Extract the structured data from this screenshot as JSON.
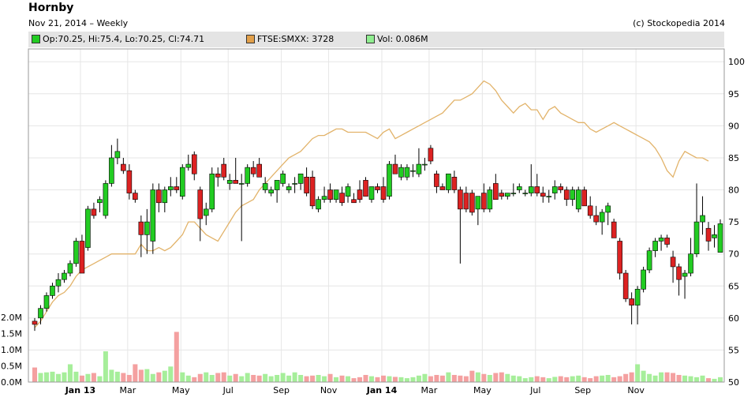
{
  "header": {
    "title": "Hornby",
    "subtitle": "Nov 21, 2014 – Weekly",
    "credit": "(c) Stockopedia 2014"
  },
  "legend": {
    "items": [
      {
        "label": "Op:70.25, Hi:75.4, Lo:70.25, Cl:74.71",
        "color": "#22cc22"
      },
      {
        "label": "FTSE:SMXX: 3728",
        "color": "#e2a04a"
      },
      {
        "label": "Vol: 0.086M",
        "color": "#90ee90"
      }
    ]
  },
  "chart_data": {
    "type": "candlestick",
    "x_ticks": [
      "Jan 13",
      "Mar",
      "May",
      "Jul",
      "Sep",
      "Nov",
      "Jan 14",
      "Mar",
      "May",
      "Jul",
      "Sep",
      "Nov"
    ],
    "y_ticks": [
      "100",
      "95",
      "90",
      "85",
      "80",
      "75",
      "70",
      "65",
      "60",
      "55",
      "50"
    ],
    "ylim": [
      50,
      102
    ],
    "volume_ticks": [
      "2.0M",
      "1.5M",
      "1.0M",
      "0.5M",
      "0.0M"
    ],
    "volume_lim": [
      0,
      2.0
    ],
    "colors": {
      "up": "#22cc22",
      "down": "#dd2222",
      "index_line": "#e2b36a",
      "vol_up": "#a6ee9a",
      "vol_down": "#f4a0a0",
      "vol_flat": "#c0c0c0"
    },
    "price": {
      "name": "Hornby",
      "candles": [
        [
          59.5,
          60.0,
          58.0,
          59.0
        ],
        [
          60.0,
          62.0,
          59.0,
          61.5
        ],
        [
          61.5,
          64.0,
          61.0,
          63.5
        ],
        [
          63.5,
          65.5,
          63.0,
          65.0
        ],
        [
          65.0,
          67.0,
          64.0,
          66.0
        ],
        [
          66.0,
          67.5,
          65.5,
          67.0
        ],
        [
          67.0,
          69.0,
          66.5,
          68.5
        ],
        [
          68.5,
          72.5,
          68.0,
          72.0
        ],
        [
          72.0,
          73.0,
          68.5,
          67.0
        ],
        [
          71.0,
          77.5,
          70.5,
          77.0
        ],
        [
          77.0,
          78.0,
          75.5,
          76.0
        ],
        [
          78.0,
          79.0,
          76.5,
          78.5
        ],
        [
          76.0,
          81.5,
          75.5,
          81.0
        ],
        [
          81.0,
          87.0,
          80.5,
          85.0
        ],
        [
          85.0,
          88.0,
          84.0,
          86.0
        ],
        [
          84.0,
          85.0,
          82.5,
          83.0
        ],
        [
          83.0,
          84.0,
          78.5,
          79.5
        ],
        [
          79.5,
          80.0,
          78.0,
          78.5
        ],
        [
          75.0,
          76.0,
          69.5,
          73.0
        ],
        [
          73.0,
          77.0,
          70.0,
          75.0
        ],
        [
          72.0,
          81.0,
          70.0,
          80.0
        ],
        [
          80.0,
          81.0,
          76.5,
          78.0
        ],
        [
          78.0,
          80.5,
          76.5,
          80.0
        ],
        [
          80.0,
          82.0,
          79.0,
          80.5
        ],
        [
          80.5,
          82.0,
          79.5,
          80.0
        ],
        [
          79.0,
          84.0,
          78.5,
          83.5
        ],
        [
          83.5,
          85.5,
          83.0,
          84.0
        ],
        [
          85.5,
          86.0,
          81.5,
          82.5
        ],
        [
          80.0,
          80.5,
          72.0,
          75.5
        ],
        [
          76.0,
          78.0,
          74.5,
          77.0
        ],
        [
          77.0,
          83.5,
          76.5,
          82.5
        ],
        [
          82.5,
          83.5,
          80.5,
          82.0
        ],
        [
          84.0,
          85.0,
          81.5,
          82.0
        ],
        [
          81.0,
          82.5,
          80.0,
          81.5
        ],
        [
          81.5,
          85.0,
          81.0,
          81.0
        ],
        [
          81.0,
          82.5,
          72.0,
          81.0
        ],
        [
          81.0,
          84.0,
          80.5,
          83.5
        ],
        [
          83.5,
          84.5,
          82.0,
          82.5
        ],
        [
          84.0,
          85.0,
          82.0,
          82.0
        ],
        [
          80.0,
          82.0,
          79.5,
          81.0
        ],
        [
          79.5,
          80.5,
          79.0,
          80.0
        ],
        [
          80.0,
          81.5,
          78.0,
          81.5
        ],
        [
          81.0,
          83.0,
          80.5,
          82.5
        ],
        [
          80.0,
          81.0,
          79.5,
          80.5
        ],
        [
          81.0,
          82.0,
          79.5,
          81.0
        ],
        [
          81.0,
          82.0,
          80.0,
          82.5
        ],
        [
          82.0,
          83.5,
          79.0,
          79.5
        ],
        [
          82.0,
          83.0,
          77.0,
          77.5
        ],
        [
          77.0,
          79.0,
          76.5,
          78.5
        ],
        [
          78.5,
          80.5,
          78.0,
          79.0
        ],
        [
          80.0,
          81.0,
          78.0,
          78.5
        ],
        [
          78.5,
          79.5,
          78.0,
          80.0
        ],
        [
          79.5,
          80.5,
          77.5,
          78.0
        ],
        [
          79.0,
          81.0,
          78.0,
          80.5
        ],
        [
          78.5,
          79.5,
          78.0,
          78.0
        ],
        [
          80.0,
          81.5,
          78.0,
          78.5
        ],
        [
          81.5,
          82.0,
          79.0,
          79.0
        ],
        [
          78.5,
          80.5,
          78.0,
          80.5
        ],
        [
          80.5,
          81.0,
          79.5,
          80.0
        ],
        [
          80.5,
          82.0,
          78.0,
          78.5
        ],
        [
          79.0,
          84.5,
          78.5,
          84.0
        ],
        [
          84.0,
          85.5,
          82.5,
          82.5
        ],
        [
          82.0,
          84.0,
          81.5,
          83.5
        ],
        [
          82.0,
          84.0,
          81.5,
          83.5
        ],
        [
          83.0,
          84.0,
          82.0,
          83.0
        ],
        [
          82.5,
          86.5,
          82.0,
          84.0
        ],
        [
          84.0,
          85.0,
          83.0,
          84.0
        ],
        [
          86.5,
          87.0,
          84.0,
          84.5
        ],
        [
          82.5,
          83.0,
          79.5,
          80.5
        ],
        [
          80.5,
          81.0,
          80.0,
          80.0
        ],
        [
          80.0,
          82.5,
          79.5,
          82.5
        ],
        [
          82.0,
          83.0,
          79.5,
          80.0
        ],
        [
          80.0,
          80.5,
          68.5,
          77.0
        ],
        [
          79.5,
          80.5,
          76.5,
          77.0
        ],
        [
          79.5,
          80.0,
          76.0,
          76.5
        ],
        [
          77.0,
          78.5,
          74.5,
          79.0
        ],
        [
          79.5,
          81.0,
          76.5,
          77.0
        ],
        [
          77.0,
          80.5,
          76.5,
          80.0
        ],
        [
          81.0,
          82.5,
          78.5,
          78.5
        ],
        [
          79.5,
          80.0,
          78.5,
          79.0
        ],
        [
          79.0,
          79.5,
          78.5,
          79.5
        ],
        [
          79.5,
          81.0,
          79.0,
          79.5
        ],
        [
          80.0,
          81.0,
          79.5,
          80.5
        ],
        [
          79.5,
          80.0,
          79.0,
          79.5
        ],
        [
          79.5,
          84.0,
          79.0,
          80.5
        ],
        [
          80.5,
          82.5,
          79.0,
          79.5
        ],
        [
          79.5,
          80.5,
          78.0,
          79.0
        ],
        [
          79.0,
          80.0,
          78.0,
          79.0
        ],
        [
          79.5,
          81.5,
          78.5,
          80.5
        ],
        [
          80.5,
          81.0,
          79.5,
          80.0
        ],
        [
          80.0,
          80.5,
          77.5,
          78.5
        ],
        [
          78.5,
          80.5,
          77.5,
          80.0
        ],
        [
          77.0,
          80.5,
          76.5,
          80.0
        ],
        [
          80.0,
          80.5,
          77.5,
          77.5
        ],
        [
          77.5,
          79.0,
          75.5,
          76.0
        ],
        [
          76.0,
          77.5,
          74.5,
          75.0
        ],
        [
          75.0,
          77.0,
          73.0,
          76.5
        ],
        [
          76.5,
          78.0,
          74.5,
          77.5
        ],
        [
          75.0,
          75.5,
          72.5,
          72.5
        ],
        [
          72.0,
          72.5,
          66.0,
          67.0
        ],
        [
          67.0,
          67.5,
          62.5,
          63.0
        ],
        [
          63.0,
          64.0,
          59.0,
          62.0
        ],
        [
          62.0,
          65.0,
          59.0,
          64.5
        ],
        [
          64.5,
          68.0,
          64.0,
          67.5
        ],
        [
          67.5,
          71.0,
          67.0,
          70.5
        ],
        [
          70.5,
          72.5,
          69.5,
          72.0
        ],
        [
          72.0,
          73.0,
          70.5,
          72.5
        ],
        [
          72.5,
          73.0,
          71.0,
          71.5
        ],
        [
          69.5,
          70.5,
          65.5,
          68.0
        ],
        [
          68.0,
          68.5,
          63.5,
          66.0
        ],
        [
          66.5,
          67.5,
          63.0,
          67.0
        ],
        [
          67.0,
          72.5,
          66.5,
          70.0
        ],
        [
          70.0,
          81.0,
          69.5,
          75.0
        ],
        [
          75.0,
          79.0,
          73.0,
          76.0
        ],
        [
          74.0,
          75.0,
          70.5,
          72.0
        ],
        [
          72.5,
          74.5,
          71.0,
          73.0
        ],
        [
          70.25,
          75.4,
          70.25,
          74.71
        ]
      ]
    },
    "index_series": {
      "name": "FTSE:SMXX",
      "values": [
        58.5,
        59.5,
        61.0,
        62.5,
        63.5,
        64.0,
        65.0,
        66.5,
        67.5,
        68.0,
        68.5,
        69.0,
        69.5,
        70.0,
        70.0,
        70.0,
        70.0,
        70.0,
        71.5,
        70.5,
        70.5,
        71.0,
        70.5,
        71.0,
        72.0,
        73.0,
        75.0,
        75.0,
        74.0,
        73.0,
        72.5,
        72.0,
        73.5,
        75.0,
        76.5,
        77.5,
        78.0,
        78.5,
        80.0,
        81.0,
        82.0,
        83.0,
        84.0,
        85.0,
        85.5,
        86.0,
        87.0,
        88.0,
        88.5,
        88.5,
        89.0,
        89.5,
        89.5,
        89.0,
        89.0,
        89.0,
        89.0,
        88.5,
        88.0,
        89.0,
        89.5,
        88.0,
        88.5,
        89.0,
        89.5,
        90.0,
        90.5,
        91.0,
        91.5,
        92.0,
        93.0,
        94.0,
        94.0,
        94.5,
        95.0,
        96.0,
        97.0,
        96.5,
        95.5,
        94.0,
        93.0,
        92.0,
        93.0,
        93.5,
        92.5,
        92.5,
        91.0,
        92.5,
        93.0,
        92.0,
        91.5,
        91.0,
        90.5,
        90.5,
        89.5,
        89.0,
        89.5,
        90.0,
        90.5,
        90.0,
        89.5,
        89.0,
        88.5,
        88.0,
        87.5,
        86.5,
        85.0,
        83.0,
        82.0,
        84.5,
        86.0,
        85.5,
        85.0,
        85.0,
        84.5
      ]
    },
    "volume": [
      0.45,
      0.28,
      0.3,
      0.32,
      0.25,
      0.3,
      0.55,
      0.32,
      0.2,
      0.25,
      0.28,
      0.18,
      0.95,
      0.38,
      0.32,
      0.28,
      0.22,
      0.55,
      0.38,
      0.4,
      0.25,
      0.3,
      0.35,
      0.48,
      1.55,
      0.3,
      0.2,
      0.15,
      0.25,
      0.3,
      0.22,
      0.28,
      0.3,
      0.2,
      0.25,
      0.18,
      0.28,
      0.22,
      0.2,
      0.25,
      0.18,
      0.22,
      0.28,
      0.2,
      0.3,
      0.22,
      0.18,
      0.2,
      0.22,
      0.18,
      0.25,
      0.15,
      0.2,
      0.18,
      0.12,
      0.15,
      0.22,
      0.18,
      0.15,
      0.2,
      0.18,
      0.16,
      0.15,
      0.12,
      0.15,
      0.2,
      0.25,
      0.18,
      0.22,
      0.2,
      0.3,
      0.22,
      0.2,
      0.18,
      0.35,
      0.3,
      0.25,
      0.22,
      0.28,
      0.3,
      0.25,
      0.2,
      0.18,
      0.12,
      0.15,
      0.18,
      0.15,
      0.12,
      0.16,
      0.18,
      0.15,
      0.18,
      0.2,
      0.15,
      0.12,
      0.18,
      0.2,
      0.22,
      0.15,
      0.18,
      0.25,
      0.3,
      0.55,
      0.35,
      0.25,
      0.2,
      0.3,
      0.3,
      0.28,
      0.22,
      0.2,
      0.18,
      0.15,
      0.2,
      0.12,
      0.1,
      0.15
    ]
  }
}
